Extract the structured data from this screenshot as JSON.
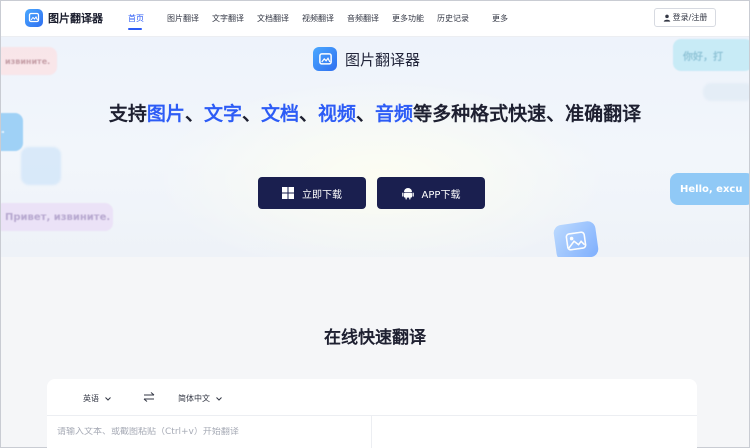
{
  "header": {
    "logo_text": "图片翻译器",
    "nav": [
      "首页",
      "图片翻译",
      "文字翻译",
      "文档翻译",
      "视频翻译",
      "音频翻译",
      "更多功能",
      "历史记录",
      "更多"
    ],
    "login_label": "登录/注册"
  },
  "hero": {
    "app_name": "图片翻译器",
    "title_prefix": "支持",
    "title_items": [
      "图片",
      "文字",
      "文档",
      "视频",
      "音频"
    ],
    "title_sep": "、",
    "title_suffix": "等多种格式快速、准确翻译",
    "download_windows": "立即下载",
    "download_app": "APP下载",
    "bubbles": {
      "ru_top": "извините.",
      "ru_bottom": "Привет, извините.",
      "zh_right": "你好，打",
      "en_right": "Hello, excu"
    }
  },
  "online": {
    "title": "在线快速翻译",
    "source_lang": "英语",
    "target_lang": "简体中文",
    "input_placeholder": "请输入文本、或截图粘贴（Ctrl+v）开始翻译"
  },
  "colors": {
    "accent": "#2d5cf6",
    "dark_button": "#1a1f4f"
  }
}
